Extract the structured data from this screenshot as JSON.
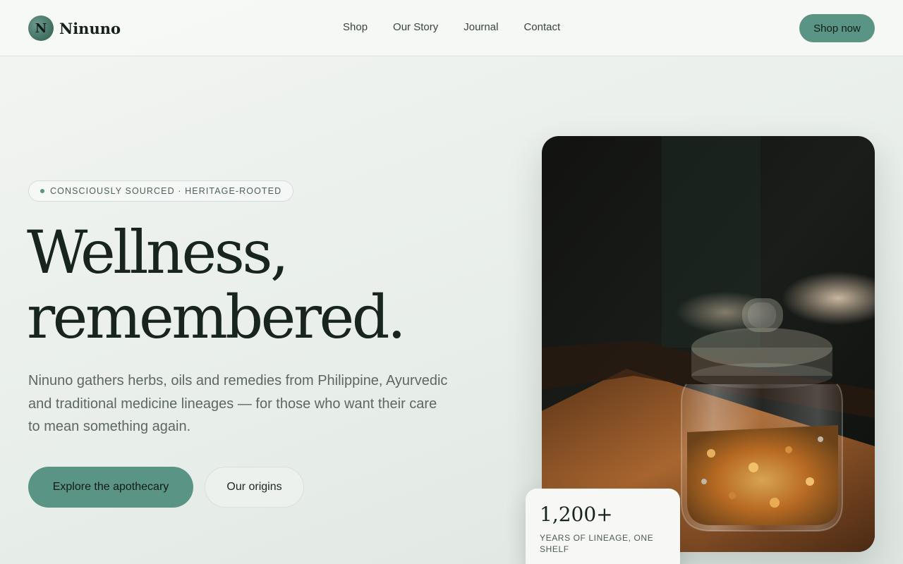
{
  "brand": {
    "name": "Ninuno",
    "mark": "N"
  },
  "nav": {
    "items": [
      "Shop",
      "Our Story",
      "Journal",
      "Contact"
    ]
  },
  "header": {
    "cta_label": "Shop now"
  },
  "hero": {
    "tagline": "CONSCIOUSLY SOURCED · HERITAGE-ROOTED",
    "headline_line1": "Wellness,",
    "headline_line2": "remembered.",
    "description": "Ninuno gathers herbs, oils and remedies from Philippine, Ayurvedic and traditional medicine lineages — for those who want their care to mean something again.",
    "primary_cta": "Explore the apothecary",
    "secondary_cta": "Our origins"
  },
  "stat": {
    "value": "1,200+",
    "label": "YEARS OF LINEAGE, ONE SHELF"
  },
  "colors": {
    "accent": "#5a9484",
    "ink": "#18241e",
    "background": "#eef2ef"
  }
}
